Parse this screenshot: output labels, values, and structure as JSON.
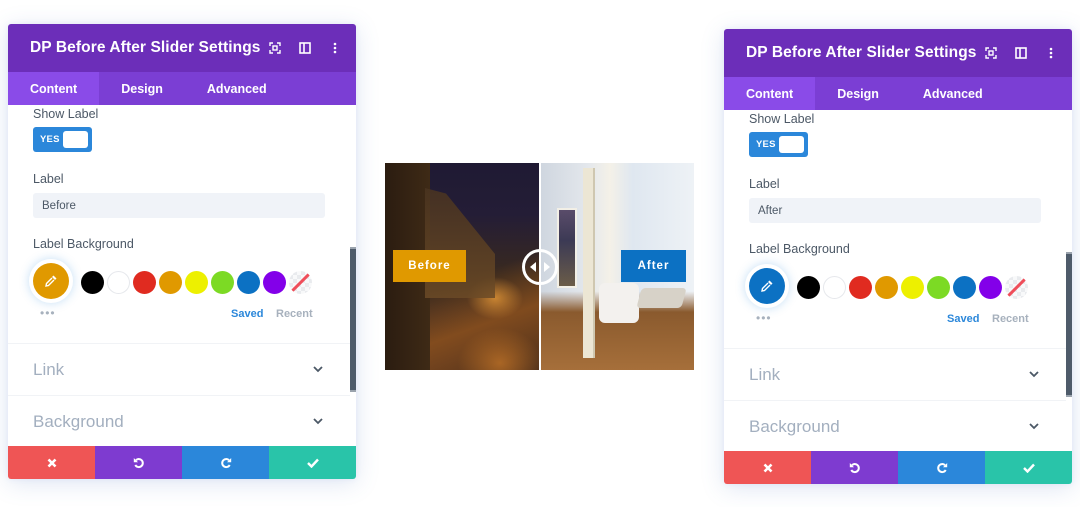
{
  "panels": [
    {
      "title": "DP Before After Slider Settings",
      "header_icons": [
        "focus-icon",
        "split-view-icon",
        "more-vertical-icon"
      ],
      "tabs": [
        {
          "label": "Content",
          "active": true
        },
        {
          "label": "Design",
          "active": false
        },
        {
          "label": "Advanced",
          "active": false
        }
      ],
      "show_label": {
        "label": "Show Label",
        "toggle_text": "YES",
        "value": true
      },
      "label_field": {
        "label": "Label",
        "value": "Before"
      },
      "label_background": {
        "label": "Label Background",
        "selected_color": "#e09900",
        "swatches": [
          "#000000",
          "#ffffff",
          "#e02b20",
          "#e09900",
          "#edf000",
          "#7cda24",
          "#0c71c3",
          "#8300e9",
          "none"
        ],
        "more_label": "•••",
        "saved_label": "Saved",
        "recent_label": "Recent"
      },
      "sections": [
        {
          "title": "Link"
        },
        {
          "title": "Background"
        }
      ],
      "footer": [
        "cancel",
        "undo",
        "redo",
        "save"
      ]
    },
    {
      "title": "DP Before After Slider Settings",
      "header_icons": [
        "focus-icon",
        "split-view-icon",
        "more-vertical-icon"
      ],
      "tabs": [
        {
          "label": "Content",
          "active": true
        },
        {
          "label": "Design",
          "active": false
        },
        {
          "label": "Advanced",
          "active": false
        }
      ],
      "show_label": {
        "label": "Show Label",
        "toggle_text": "YES",
        "value": true
      },
      "label_field": {
        "label": "Label",
        "value": "After"
      },
      "label_background": {
        "label": "Label Background",
        "selected_color": "#0c71c3",
        "swatches": [
          "#000000",
          "#ffffff",
          "#e02b20",
          "#e09900",
          "#edf000",
          "#7cda24",
          "#0c71c3",
          "#8300e9",
          "none"
        ],
        "more_label": "•••",
        "saved_label": "Saved",
        "recent_label": "Recent"
      },
      "sections": [
        {
          "title": "Link"
        },
        {
          "title": "Background"
        }
      ],
      "footer": [
        "cancel",
        "undo",
        "redo",
        "save"
      ]
    }
  ],
  "slider": {
    "before_label": "Before",
    "after_label": "After",
    "before_label_color": "#e09900",
    "after_label_color": "#0c71c3",
    "position": 0.5
  },
  "colors": {
    "header": "#6c2eb9",
    "tabs": "#7b3ed4",
    "active_tab": "#8a4be8",
    "toggle": "#2b87da",
    "cancel": "#ef5555",
    "undo": "#7e3bd0",
    "redo": "#2b87da",
    "save": "#29c4a9"
  }
}
